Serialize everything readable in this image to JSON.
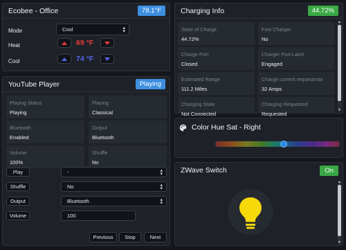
{
  "ecobee": {
    "title": "Ecobee - Office",
    "temp_badge": "78.1°F",
    "mode_label": "Mode",
    "mode_value": "Cool",
    "heat_label": "Heat",
    "heat_value": "69 °F",
    "cool_label": "Cool",
    "cool_value": "74 °F",
    "colors": {
      "heat": "#e83a3a",
      "cool": "#5566e8"
    }
  },
  "youtube": {
    "title": "YouTube Player",
    "status_badge": "Playing",
    "tiles": [
      {
        "label": "Playing Status",
        "value": "Playing"
      },
      {
        "label": "Playing",
        "value": "Classical"
      },
      {
        "label": "Bluetooth",
        "value": "Enabled"
      },
      {
        "label": "Output",
        "value": "Bluetooth"
      },
      {
        "label": "Volume",
        "value": "100%"
      },
      {
        "label": "Shuffle",
        "value": "No"
      }
    ],
    "controls": [
      {
        "button": "Play",
        "value": "-"
      },
      {
        "button": "Shuffle",
        "value": "No"
      },
      {
        "button": "Output",
        "value": "Bluetooth"
      },
      {
        "button": "Volume",
        "value": "100"
      }
    ],
    "footer_buttons": [
      "Previous",
      "Stop",
      "Next"
    ]
  },
  "charging": {
    "title": "Charging Info",
    "badge": "44.72%",
    "tiles": [
      {
        "label": "State of Charge",
        "value": "44.72%"
      },
      {
        "label": "Fast Charger",
        "value": "No"
      },
      {
        "label": "Charge Port",
        "value": "Closed"
      },
      {
        "label": "Charger Port Latch",
        "value": "Engaged"
      },
      {
        "label": "Estimated Range",
        "value": "111.2 Miles"
      },
      {
        "label": "Charge current requestmax",
        "value": "32 Amps"
      },
      {
        "label": "Charging State",
        "value": "Not Connected"
      },
      {
        "label": "Charging Requested",
        "value": "Requested"
      }
    ]
  },
  "color_hue": {
    "title": "Color Hue Sat - Right",
    "icon": "palette-icon",
    "hue_fraction": 0.55
  },
  "zwave": {
    "title": "ZWave Switch",
    "badge": "On",
    "icon": "lightbulb-icon",
    "bulb_color": "#f5d90a"
  }
}
